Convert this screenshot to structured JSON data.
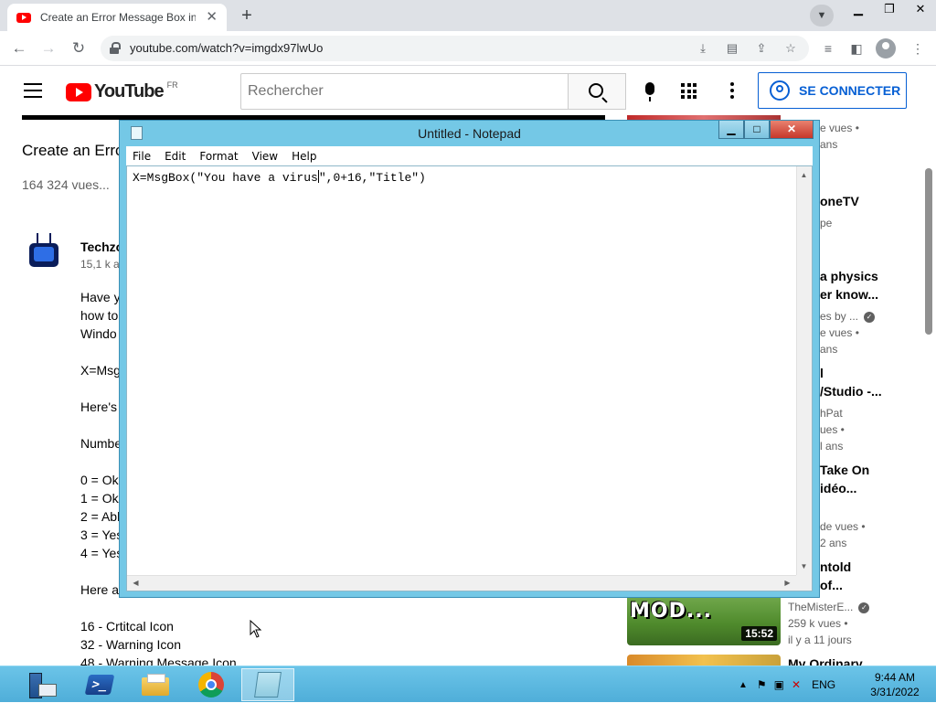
{
  "browser": {
    "tab_title": "Create an Error Message Box in N",
    "tab_close": "✕",
    "new_tab": "+",
    "url": "youtube.com/watch?v=imgdx97lwUo"
  },
  "youtube": {
    "logo_text": "YouTube",
    "region": "FR",
    "search_placeholder": "Rechercher",
    "signin_label": "SE CONNECTER",
    "video_title": "Create an Erro",
    "views": "164 324 vues...",
    "channel_name": "Techzo",
    "channel_subs": "15,1 k a",
    "description_lines": [
      "Have y",
      "how to",
      "Windo",
      "X=Msg",
      "Here's",
      "Numbe",
      "0 = Ok",
      "1 = Ok/",
      "2 = Abb",
      "3 = Yes",
      "4 = Yes",
      "Here a",
      "16 - Crtitcal Icon",
      "32 - Warning Icon",
      "48 - Warning Message Icon"
    ],
    "recommendations": [
      {
        "line1": "e vues •",
        "line2": "ans"
      },
      {
        "title1": "oneTV",
        "line1": "pe"
      },
      {
        "title1": "a physics",
        "title2": "er know...",
        "line1": "es by ...",
        "line2": "e vues •",
        "line3": "ans"
      },
      {
        "title1": "l",
        "title2": "/Studio -...",
        "line1": "hPat",
        "line2": "ues •",
        "line3": "l ans"
      },
      {
        "title1": "Take On",
        "title2": "idéo...",
        "line1": "de vues •",
        "line2": "2 ans"
      },
      {
        "title1": "ntold",
        "title2": "of...",
        "line1": "TheMisterE...",
        "line2": "259 k vues •",
        "line3": "il y a 11 jours",
        "thumb_text": "MOD...",
        "duration": "15:52"
      },
      {
        "title1": "My Ordinary"
      }
    ]
  },
  "notepad": {
    "title": "Untitled - Notepad",
    "menu": [
      "File",
      "Edit",
      "Format",
      "View",
      "Help"
    ],
    "text_before_caret": "X=MsgBox(\"You have a virus",
    "text_after_caret": "\",0+16,\"Title\")"
  },
  "taskbar": {
    "clock_time": "9:44 AM",
    "clock_date": "3/31/2022",
    "language": "ENG"
  }
}
